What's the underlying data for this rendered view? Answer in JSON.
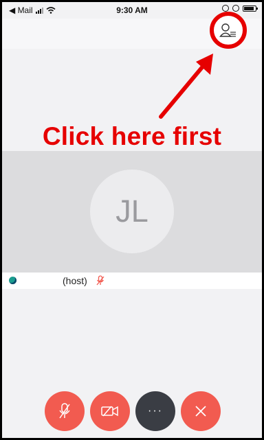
{
  "status_bar": {
    "back_app": "◀ Mail",
    "time": "9:30 AM"
  },
  "annotation": {
    "text": "Click here first",
    "color": "#e60000"
  },
  "participant": {
    "initials": "JL",
    "role_label": "(host)"
  },
  "controls": {
    "more_label": "···"
  },
  "colors": {
    "button_red": "#f25b50",
    "button_dark": "#3a3d44",
    "status_green": "#1a9c8f"
  }
}
